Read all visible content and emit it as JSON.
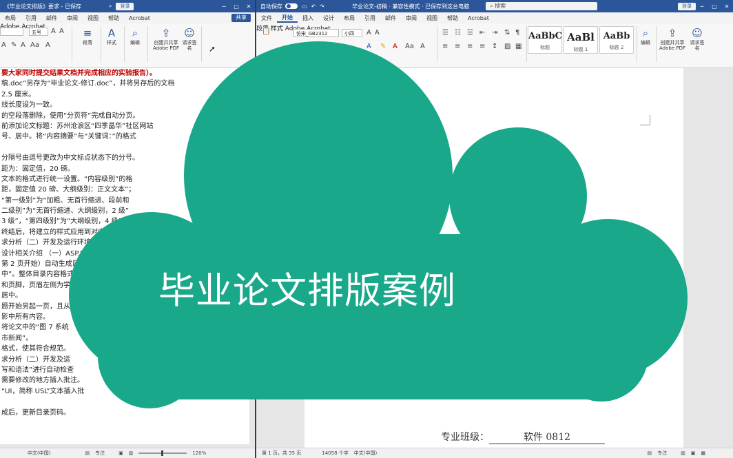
{
  "left_window": {
    "title": "《毕业论文排版》要求 - 已保存",
    "login_label": "登录",
    "tabs": [
      {
        "label": "布局"
      },
      {
        "label": "引用"
      },
      {
        "label": "邮件"
      },
      {
        "label": "审阅"
      },
      {
        "label": "视图"
      },
      {
        "label": "帮助"
      },
      {
        "label": "Acrobat"
      }
    ],
    "share_label": "共享",
    "ribbon": {
      "font_size": "五号",
      "style_group": "样式",
      "edit_group": "编辑",
      "create_share_pdf": "创建并共享 Adobe PDF",
      "request_sign": "请求签名",
      "acrobat_group": "Adobe Acrobat",
      "paragraph_btn": "段落"
    },
    "doc_lines": [
      "要大家同时提交结果文档并完成相应的实验报告）。",
      "稿.doc”另存为“毕业论文-修订.doc”，并将另存后的文档",
      "2.5 厘米。",
      "线长度设为一致。",
      "的空段落删除，使用“分页符”完成自动分页。",
      "前添加论文标题：苏州沧浪区“四季晶华”社区网站",
      "号、居中。将“内容摘要”与“关键词：”的格式",
      "",
      "分隔号由逗号更改为中文标点状态下的分号。",
      "距为：固定值，20 磅。",
      "文本的格式进行统一设置。“内容级别”的格",
      "距，固定值 20 磅、大纲级别：正文文本”；",
      "“第一级别”为“加粗、无首行缩进、段前和",
      "二级别”为“无首行缩进、大纲级别，2 级”",
      "3 级”，“第四级别”为“大纲级别，4 级”。",
      "终结后，将建立的样式应用到对应的段落中",
      "求分析（二）开发及运行环境”中的",
      "设计相关介绍 （一）ASP.NET 技术",
      "第 2 页开始）自动生成目录。",
      "中”。整体目录内容格式“宋",
      "和页脚，页眉左侧为学校",
      "居中。",
      "题开始另起一页，且从",
      "影中所有内容。",
      "将论文中的“图 7 系统",
      "市新闻”。",
      "格式，使其符合规范。",
      "求分析（二）开发及运",
      "写和语法”进行自动检查",
      "需要修改的地方插入批注。",
      "“UI，简称 USL”文本插入批",
      "",
      "成后，更新目录页码。"
    ],
    "status": {
      "lang": "中文(中国)",
      "focus": "专注",
      "zoom": "120%"
    }
  },
  "right_window": {
    "autosave_label": "自动保存",
    "title": "毕业论文-初稿 · 兼容性模式 · 已保存到这台电脑",
    "search_label": "搜索",
    "login_label": "登录",
    "tabs": [
      {
        "label": "文件"
      },
      {
        "label": "开始",
        "active": true
      },
      {
        "label": "插入"
      },
      {
        "label": "设计"
      },
      {
        "label": "布局"
      },
      {
        "label": "引用"
      },
      {
        "label": "邮件"
      },
      {
        "label": "审阅"
      },
      {
        "label": "视图"
      },
      {
        "label": "帮助"
      },
      {
        "label": "Acrobat"
      }
    ],
    "ribbon": {
      "font_name": "仿宋_GB2312",
      "font_size": "小四",
      "paragraph_group": "段落",
      "styles_group": "样式",
      "styles": [
        {
          "sample": "AaBbC",
          "name": "标题"
        },
        {
          "sample": "AaBl",
          "name": "标题 1"
        },
        {
          "sample": "AaBb",
          "name": "标题 2"
        }
      ],
      "edit_group": "编辑",
      "create_share_pdf": "创建并共享 Adobe PDF",
      "request_sign": "请求签名",
      "acrobat_group": "Adobe Acrobat"
    },
    "page": {
      "major_label": "专业班级：",
      "major_value": "软件 0812"
    },
    "status": {
      "page_info": "第 1 页，共 35 页",
      "word_count": "14058 个字",
      "lang": "中文(中国)",
      "focus": "专注"
    }
  },
  "overlay": {
    "banner_text": "毕业论文排版案例",
    "cloud_color": "#1aa88a"
  },
  "colors": {
    "word_blue": "#2b579a",
    "heading_red": "#c00000"
  }
}
